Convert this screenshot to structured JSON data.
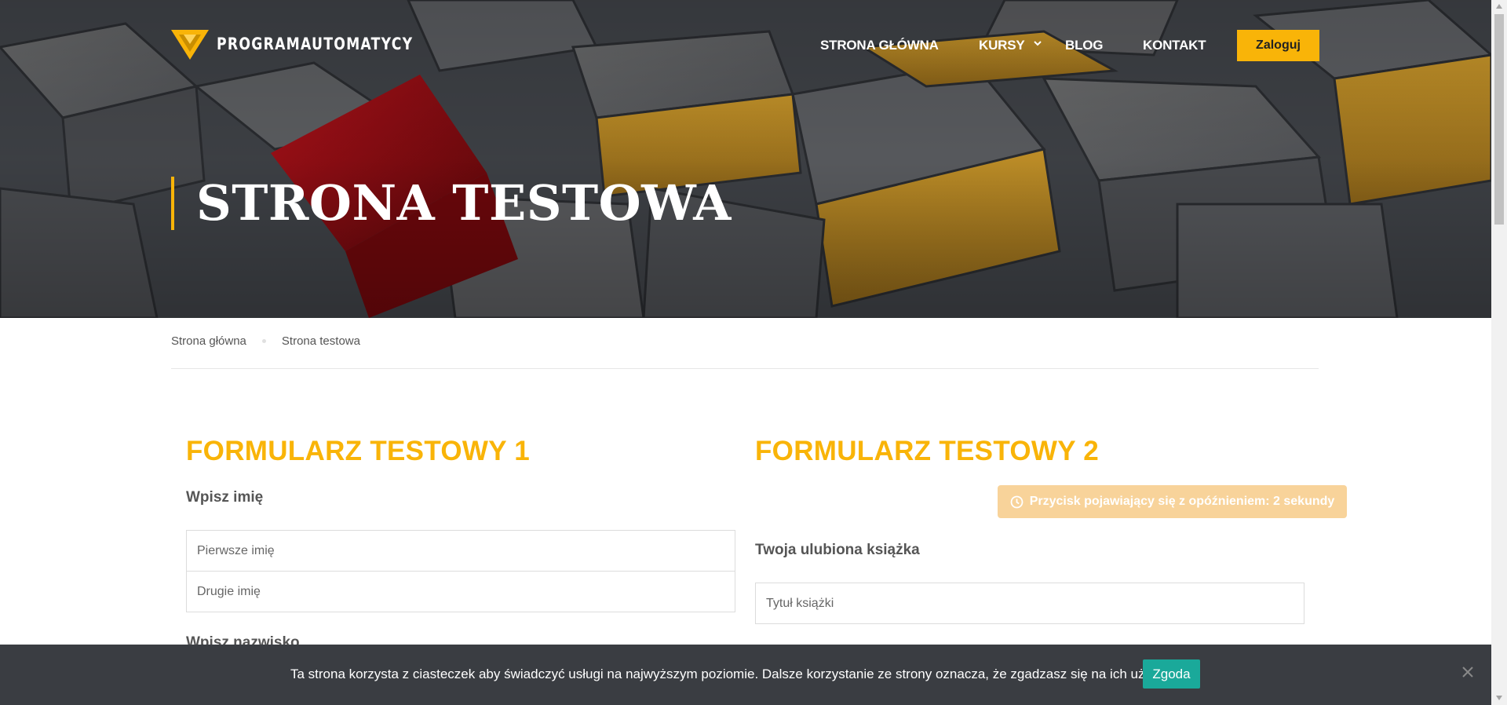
{
  "brand": {
    "name": "PROGRAMAUTOMATYCY",
    "accent": "#f9b408"
  },
  "nav": {
    "items": [
      "STRONA GŁÓWNA",
      "KURSY",
      "BLOG",
      "KONTAKT"
    ],
    "login_label": "Zaloguj"
  },
  "hero": {
    "title": "STRONA TESTOWA"
  },
  "breadcrumb": [
    "Strona główna",
    "Strona testowa"
  ],
  "form1": {
    "title": "FORMULARZ TESTOWY 1",
    "name_label": "Wpisz imię",
    "first_name_placeholder": "Pierwsze imię",
    "second_name_placeholder": "Drugie imię",
    "surname_label": "Wpisz nazwisko"
  },
  "form2": {
    "title": "FORMULARZ TESTOWY 2",
    "delayed_button_label": "Przycisk pojawiający się z opóźnieniem: 2 sekundy",
    "book_label": "Twoja ulubiona książka",
    "book_placeholder": "Tytuł książki"
  },
  "cookie": {
    "text": "Ta strona korzysta z ciasteczek aby świadczyć usługi na najwyższym poziomie. Dalsze korzystanie ze strony oznacza, że zgadzasz się na ich użycie.",
    "accept_label": "Zgoda",
    "background": "#3a3d42",
    "accept_color": "#1aa99a"
  },
  "icons": {
    "logo": "logo-triangle-icon",
    "dropdown": "chevron-down-icon",
    "clock": "clock-icon",
    "close": "close-icon"
  }
}
